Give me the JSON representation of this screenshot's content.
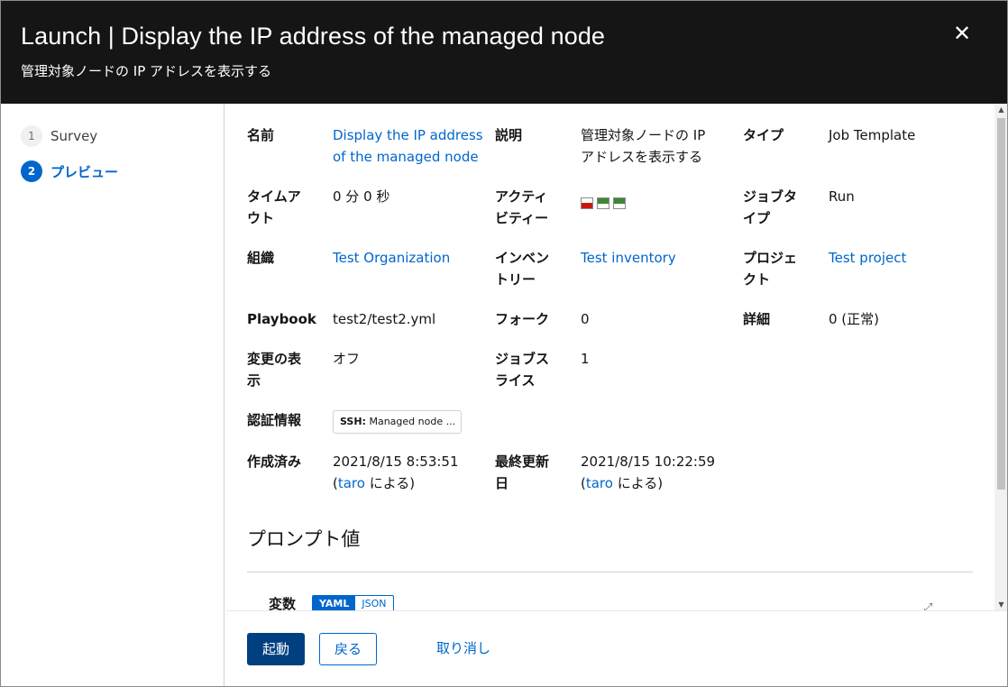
{
  "header": {
    "title": "Launch | Display the IP address of the managed node",
    "subtitle": "管理対象ノードの IP アドレスを表示する",
    "close_icon": "close-icon"
  },
  "nav": {
    "steps": [
      {
        "number": "1",
        "label": "Survey",
        "active": false
      },
      {
        "number": "2",
        "label": "プレビュー",
        "active": true
      }
    ]
  },
  "details": {
    "name_label": "名前",
    "name_line1": "Display the IP address",
    "name_line2": "of the managed node",
    "description_label": "説明",
    "description_line1": "管理対象ノードの IP",
    "description_line2": "アドレスを表示する",
    "type_label": "タイプ",
    "type_value": "Job Template",
    "timeout_label_line1": "タイムア",
    "timeout_label_line2": "ウト",
    "timeout_value": "0 分 0 秒",
    "activity_label_line1": "アクティ",
    "activity_label_line2": "ビティー",
    "activity_statuses": [
      "failed",
      "successful",
      "successful"
    ],
    "job_type_label_line1": "ジョブタ",
    "job_type_label_line2": "イプ",
    "job_type_value": "Run",
    "organization_label": "組織",
    "organization_value": "Test Organization",
    "inventory_label_line1": "インベン",
    "inventory_label_line2": "トリー",
    "inventory_value": "Test inventory",
    "project_label_line1": "プロジェ",
    "project_label_line2": "クト",
    "project_value": "Test project",
    "playbook_label": "Playbook",
    "playbook_value": "test2/test2.yml",
    "forks_label": "フォーク",
    "forks_value": "0",
    "verbosity_label": "詳細",
    "verbosity_value": "0 (正常)",
    "show_changes_label_line1": "変更の表",
    "show_changes_label_line2": "示",
    "show_changes_value": "オフ",
    "job_slice_label_line1": "ジョブス",
    "job_slice_label_line2": "ライス",
    "job_slice_value": "1",
    "credentials_label": "認証情報",
    "credential_chip_prefix": "SSH:",
    "credential_chip_text": " Managed node ...",
    "created_label": "作成済み",
    "created_date": "2021/8/15 8:53:51",
    "created_by_open": "(",
    "created_by_user": "taro",
    "created_by_close": " による)",
    "modified_label_line1": "最終更新",
    "modified_label_line2": "日",
    "modified_date": "2021/8/15 10:22:59",
    "modified_by_open": "(",
    "modified_by_user": "taro",
    "modified_by_close": " による)"
  },
  "prompt": {
    "title": "プロンプト値",
    "variables_label": "変数",
    "yaml_label": "YAML",
    "json_label": "JSON",
    "expand_icon": "expand-icon"
  },
  "footer": {
    "launch_label": "起動",
    "back_label": "戻る",
    "cancel_label": "取り消し"
  },
  "colors": {
    "header_bg": "#151515",
    "link": "#0066cc",
    "primary_button": "#004080",
    "activity_failed": "#c9190b",
    "activity_success": "#3e8635"
  }
}
